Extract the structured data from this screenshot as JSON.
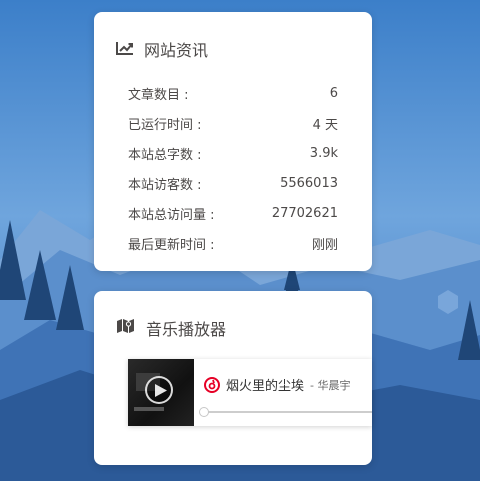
{
  "site_info": {
    "title": "网站资讯",
    "stats": [
      {
        "label": "文章数目 :",
        "value": "6"
      },
      {
        "label": "已运行时间 :",
        "value": "4 天"
      },
      {
        "label": "本站总字数 :",
        "value": "3.9k"
      },
      {
        "label": "本站访客数 :",
        "value": "5566013"
      },
      {
        "label": "本站总访问量 :",
        "value": "27702621"
      },
      {
        "label": "最后更新时间 :",
        "value": "刚刚"
      }
    ]
  },
  "music": {
    "title": "音乐播放器",
    "song_title": "烟火里的尘埃",
    "song_artist": "- 华晨宇",
    "progress": 0
  },
  "icons": {
    "info": "trend-chart-icon",
    "music": "map-icon",
    "play": "play-icon",
    "provider": "netease-music-icon"
  },
  "colors": {
    "sky_top": "#3f82c9",
    "card_text": "#4c4948",
    "netease_red": "#e60026"
  }
}
